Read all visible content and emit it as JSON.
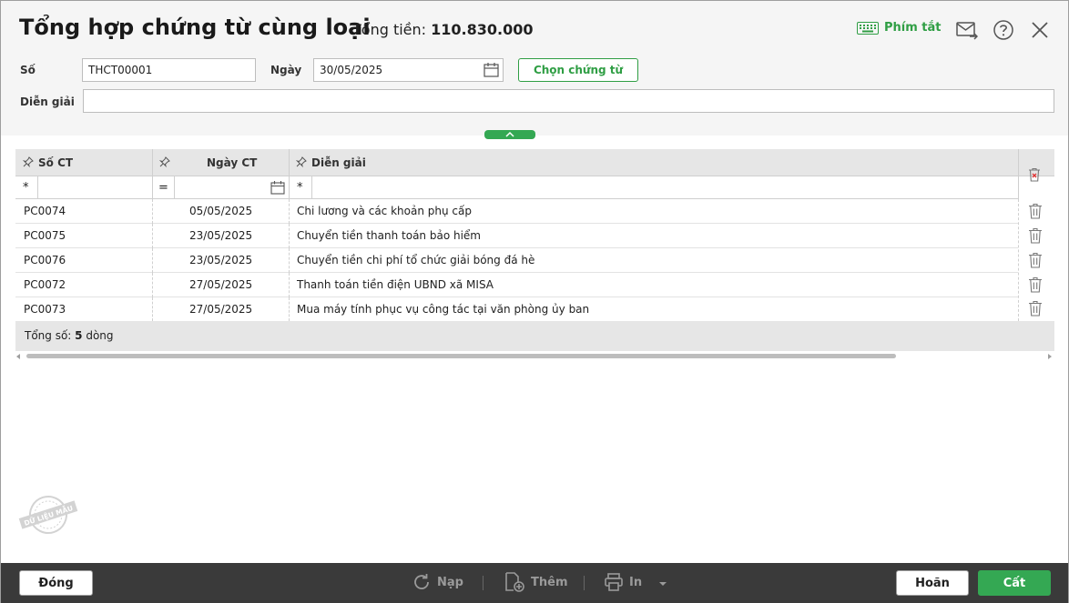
{
  "header": {
    "title": "Tổng hợp chứng từ cùng loại",
    "total_label": "Tổng tiền:",
    "total_value": "110.830.000",
    "shortcut_label": "Phím tắt"
  },
  "form": {
    "so_label": "Số",
    "so_value": "THCT00001",
    "ngay_label": "Ngày",
    "ngay_value": "30/05/2025",
    "choose_button": "Chọn chứng từ",
    "diengiai_label": "Diễn giải",
    "diengiai_value": ""
  },
  "grid": {
    "columns": [
      "Số CT",
      "Ngày CT",
      "Diễn giải"
    ],
    "filters": [
      "*",
      "=",
      "*"
    ],
    "rows": [
      {
        "so_ct": "PC0074",
        "ngay_ct": "05/05/2025",
        "dien_giai": "Chi lương và các khoản phụ cấp"
      },
      {
        "so_ct": "PC0075",
        "ngay_ct": "23/05/2025",
        "dien_giai": "Chuyển tiền thanh toán bảo hiểm"
      },
      {
        "so_ct": "PC0076",
        "ngay_ct": "23/05/2025",
        "dien_giai": "Chuyển tiền chi phí tổ chức giải bóng đá hè"
      },
      {
        "so_ct": "PC0072",
        "ngay_ct": "27/05/2025",
        "dien_giai": "Thanh toán tiền điện UBND xã MISA"
      },
      {
        "so_ct": "PC0073",
        "ngay_ct": "27/05/2025",
        "dien_giai": "Mua máy tính phục vụ công tác tại văn phòng ủy ban"
      }
    ],
    "summary_prefix": "Tổng số: ",
    "summary_count": "5",
    "summary_suffix": " dòng"
  },
  "stamp": {
    "text": "DỮ LIỆU MẪU"
  },
  "toolbar": {
    "close": "Đóng",
    "reload": "Nạp",
    "add": "Thêm",
    "print": "In",
    "cancel": "Hoãn",
    "save": "Cất"
  },
  "colors": {
    "accent": "#34a853",
    "bottom_bar": "#3a3a3a",
    "header_bg": "#f5f5f5"
  }
}
